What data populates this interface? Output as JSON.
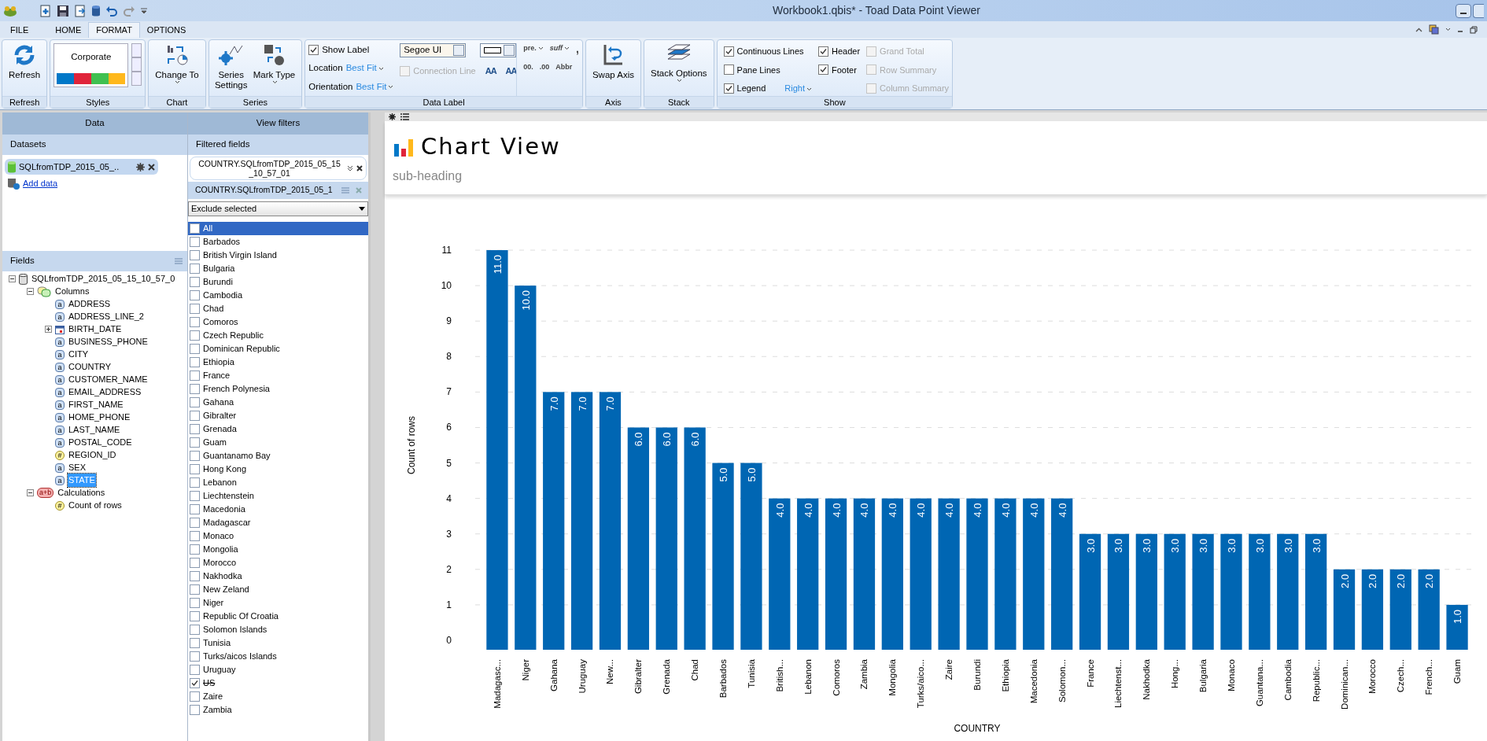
{
  "window": {
    "title": "Workbook1.qbis* - Toad Data Point Viewer"
  },
  "menu_tabs": [
    {
      "label": "FILE",
      "selected": false
    },
    {
      "label": "HOME",
      "selected": false
    },
    {
      "label": "FORMAT",
      "selected": true
    },
    {
      "label": "OPTIONS",
      "selected": false
    }
  ],
  "ribbon": {
    "refresh": {
      "button": "Refresh",
      "group": "Refresh"
    },
    "styles": {
      "gallery_item": "Corporate",
      "group": "Styles"
    },
    "chart": {
      "button": "Change To",
      "group": "Chart"
    },
    "series": {
      "buttons": [
        "Series Settings",
        "Mark Type"
      ],
      "group": "Series"
    },
    "data_label": {
      "show_label": {
        "label": "Show Label",
        "checked": true
      },
      "location": {
        "label": "Location",
        "value": "Best Fit"
      },
      "orientation": {
        "label": "Orientation",
        "value": "Best Fit"
      },
      "font": "Segoe UI",
      "connection_line": {
        "label": "Connection Line",
        "checked": false,
        "disabled": true
      },
      "grow_font": "AA",
      "shrink_font": "AA",
      "prefix": "pre.",
      "suffix": "suff",
      "separator": ",",
      "decrease_decimal": "00.",
      "increase_decimal": ".00",
      "abbr": "Abbr",
      "group": "Data Label"
    },
    "axis": {
      "button": "Swap Axis",
      "group": "Axis"
    },
    "stack": {
      "button": "Stack Options",
      "group": "Stack"
    },
    "show": {
      "options": [
        {
          "label": "Continuous Lines",
          "checked": true,
          "disabled": false
        },
        {
          "label": "Pane Lines",
          "checked": false,
          "disabled": false
        },
        {
          "label": "Legend",
          "checked": true,
          "disabled": false
        },
        {
          "label": "Header",
          "checked": true,
          "disabled": false
        },
        {
          "label": "Footer",
          "checked": true,
          "disabled": false
        },
        {
          "label": "Grand Total",
          "checked": false,
          "disabled": true
        },
        {
          "label": "Row Summary",
          "checked": false,
          "disabled": true
        },
        {
          "label": "Column Summary",
          "checked": false,
          "disabled": true
        }
      ],
      "legend_position": "Right",
      "group": "Show"
    }
  },
  "data_panel": {
    "title": "Data",
    "datasets_header": "Datasets",
    "datasets": [
      {
        "name": "SQLfromTDP_2015_05_..",
        "selected": true
      }
    ],
    "add_data": "Add data",
    "fields_header": "Fields",
    "tree": [
      {
        "label": "SQLfromTDP_2015_05_15_10_57_0",
        "kind": "table",
        "expanded": true,
        "selected": false,
        "children": [
          {
            "label": "Columns",
            "kind": "folder",
            "expanded": true,
            "selected": false,
            "children": [
              {
                "label": "ADDRESS",
                "kind": "field",
                "badge": "a",
                "selected": false
              },
              {
                "label": "ADDRESS_LINE_2",
                "kind": "field",
                "badge": "a",
                "selected": false
              },
              {
                "label": "BIRTH_DATE",
                "kind": "date",
                "expanded": false,
                "selected": false
              },
              {
                "label": "BUSINESS_PHONE",
                "kind": "field",
                "badge": "a",
                "selected": false
              },
              {
                "label": "CITY",
                "kind": "field",
                "badge": "a",
                "selected": false
              },
              {
                "label": "COUNTRY",
                "kind": "field",
                "badge": "a",
                "selected": false
              },
              {
                "label": "CUSTOMER_NAME",
                "kind": "field",
                "badge": "a",
                "selected": false
              },
              {
                "label": "EMAIL_ADDRESS",
                "kind": "field",
                "badge": "a",
                "selected": false
              },
              {
                "label": "FIRST_NAME",
                "kind": "field",
                "badge": "a",
                "selected": false
              },
              {
                "label": "HOME_PHONE",
                "kind": "field",
                "badge": "a",
                "selected": false
              },
              {
                "label": "LAST_NAME",
                "kind": "field",
                "badge": "a",
                "selected": false
              },
              {
                "label": "POSTAL_CODE",
                "kind": "field",
                "badge": "a",
                "selected": false
              },
              {
                "label": "REGION_ID",
                "kind": "number",
                "badge": "#",
                "selected": false
              },
              {
                "label": "SEX",
                "kind": "field",
                "badge": "a",
                "selected": false
              },
              {
                "label": "STATE",
                "kind": "field",
                "badge": "a",
                "selected": true
              }
            ]
          },
          {
            "label": "Calculations",
            "kind": "calc",
            "badge": "a+b",
            "expanded": true,
            "selected": false,
            "children": [
              {
                "label": "Count of rows",
                "kind": "number",
                "badge": "#",
                "selected": false
              }
            ]
          }
        ]
      }
    ]
  },
  "filter_panel": {
    "title": "View filters",
    "filtered_fields_header": "Filtered fields",
    "filtered_field": "COUNTRY.SQLfromTDP_2015_05_15 _10_57_01",
    "filter_header": "COUNTRY.SQLfromTDP_2015_05_1",
    "mode": "Exclude selected",
    "items": [
      {
        "label": "All",
        "checked": false,
        "selected": true
      },
      {
        "label": "Barbados",
        "checked": false,
        "selected": false
      },
      {
        "label": "British Virgin Island",
        "checked": false,
        "selected": false
      },
      {
        "label": "Bulgaria",
        "checked": false,
        "selected": false
      },
      {
        "label": "Burundi",
        "checked": false,
        "selected": false
      },
      {
        "label": "Cambodia",
        "checked": false,
        "selected": false
      },
      {
        "label": "Chad",
        "checked": false,
        "selected": false
      },
      {
        "label": "Comoros",
        "checked": false,
        "selected": false
      },
      {
        "label": "Czech Republic",
        "checked": false,
        "selected": false
      },
      {
        "label": "Dominican Republic",
        "checked": false,
        "selected": false
      },
      {
        "label": "Ethiopia",
        "checked": false,
        "selected": false
      },
      {
        "label": "France",
        "checked": false,
        "selected": false
      },
      {
        "label": "French Polynesia",
        "checked": false,
        "selected": false
      },
      {
        "label": "Gahana",
        "checked": false,
        "selected": false
      },
      {
        "label": "Gibralter",
        "checked": false,
        "selected": false
      },
      {
        "label": "Grenada",
        "checked": false,
        "selected": false
      },
      {
        "label": "Guam",
        "checked": false,
        "selected": false
      },
      {
        "label": "Guantanamo Bay",
        "checked": false,
        "selected": false
      },
      {
        "label": "Hong Kong",
        "checked": false,
        "selected": false
      },
      {
        "label": "Lebanon",
        "checked": false,
        "selected": false
      },
      {
        "label": "Liechtenstein",
        "checked": false,
        "selected": false
      },
      {
        "label": "Macedonia",
        "checked": false,
        "selected": false
      },
      {
        "label": "Madagascar",
        "checked": false,
        "selected": false
      },
      {
        "label": "Monaco",
        "checked": false,
        "selected": false
      },
      {
        "label": "Mongolia",
        "checked": false,
        "selected": false
      },
      {
        "label": "Morocco",
        "checked": false,
        "selected": false
      },
      {
        "label": "Nakhodka",
        "checked": false,
        "selected": false
      },
      {
        "label": "New Zeland",
        "checked": false,
        "selected": false
      },
      {
        "label": "Niger",
        "checked": false,
        "selected": false
      },
      {
        "label": "Republic Of Croatia",
        "checked": false,
        "selected": false
      },
      {
        "label": "Solomon Islands",
        "checked": false,
        "selected": false
      },
      {
        "label": "Tunisia",
        "checked": false,
        "selected": false
      },
      {
        "label": "Turks/aicos Islands",
        "checked": false,
        "selected": false
      },
      {
        "label": "Uruguay",
        "checked": false,
        "selected": false
      },
      {
        "label": "US",
        "checked": true,
        "selected": false
      },
      {
        "label": "Zaire",
        "checked": false,
        "selected": false
      },
      {
        "label": "Zambia",
        "checked": false,
        "selected": false
      }
    ]
  },
  "chart_view": {
    "title": "Chart View",
    "subheading": "sub-heading",
    "chart_data": {
      "type": "bar",
      "xlabel": "COUNTRY",
      "ylabel": "Count of rows",
      "categories": [
        "Madagasc...",
        "Niger",
        "Gahana",
        "Uruguay",
        "New...",
        "Gibralter",
        "Grenada",
        "Chad",
        "Barbados",
        "Tunisia",
        "British...",
        "Lebanon",
        "Comoros",
        "Zambia",
        "Mongolia",
        "Turks/aico...",
        "Zaire",
        "Burundi",
        "Ethiopia",
        "Macedonia",
        "Solomon...",
        "France",
        "Liechtenst...",
        "Nakhodka",
        "Hong...",
        "Bulgaria",
        "Monaco",
        "Guantana...",
        "Cambodia",
        "Republic...",
        "Dominican...",
        "Morocco",
        "Czech...",
        "French...",
        "Guam"
      ],
      "grid": true,
      "series": [
        {
          "color": "#0066b3",
          "values": [
            11,
            10,
            7,
            7,
            7,
            6,
            6,
            6,
            5,
            5,
            4,
            4,
            4,
            4,
            4,
            4,
            4,
            4,
            4,
            4,
            4,
            3,
            3,
            3,
            3,
            3,
            3,
            3,
            3,
            3,
            2,
            2,
            2,
            2,
            1
          ]
        }
      ],
      "ylim": [
        0,
        11
      ],
      "yticks": [
        0,
        1,
        2,
        3,
        4,
        5,
        6,
        7,
        8,
        9,
        10,
        11
      ],
      "value_labels": [
        "11.0",
        "10.0",
        "7.0",
        "7.0",
        "7.0",
        "6.0",
        "6.0",
        "6.0",
        "5.0",
        "5.0",
        "4.0",
        "4.0",
        "4.0",
        "4.0",
        "4.0",
        "4.0",
        "4.0",
        "4.0",
        "4.0",
        "4.0",
        "4.0",
        "3.0",
        "3.0",
        "3.0",
        "3.0",
        "3.0",
        "3.0",
        "3.0",
        "3.0",
        "3.0",
        "2.0",
        "2.0",
        "2.0",
        "2.0",
        "1.0"
      ]
    }
  }
}
